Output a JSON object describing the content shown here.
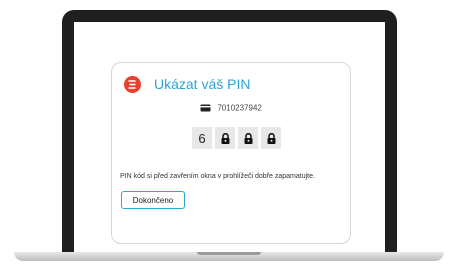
{
  "dialog": {
    "title": "Ukázat váš PIN",
    "card_number": "7010237942",
    "pin_digits": [
      "6",
      "lock",
      "lock",
      "lock"
    ],
    "note": "PIN kód si před zavřením okna v prohlížeči dobře zapamatujte.",
    "done_label": "Dokončeno"
  },
  "colors": {
    "accent": "#2aa6d6",
    "logo": "#e8402d",
    "pin_box": "#e7e7e7"
  },
  "icons": {
    "logo": "bank-logo-icon",
    "card": "credit-card-icon",
    "lock": "lock-icon"
  }
}
